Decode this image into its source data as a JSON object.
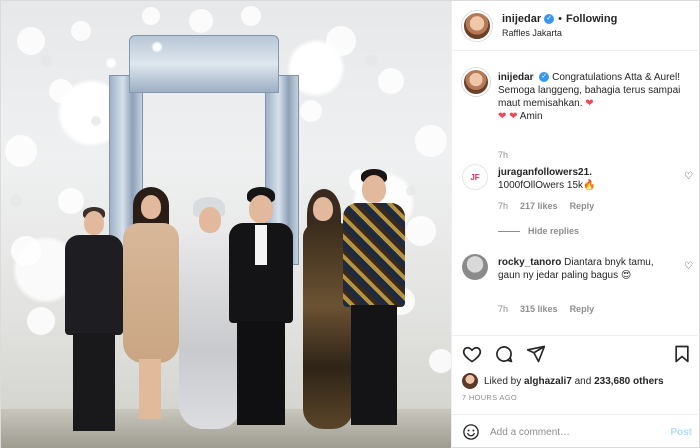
{
  "header": {
    "username": "inijedar",
    "separator": "•",
    "follow_state": "Following",
    "location": "Raffles Jakarta"
  },
  "caption": {
    "username": "inijedar",
    "text": "Congratulations Atta & Aurel! Semoga langgeng, bahagia terus sampai maut memisahkan.",
    "hearts_after": "❤",
    "hearts_line": "❤ ❤",
    "amin": "Amin",
    "time": "7h"
  },
  "comments": [
    {
      "username": "juraganfollowers21.",
      "text": "1000fOllOwers 15k",
      "emoji": "🔥",
      "time": "7h",
      "likes": "217 likes",
      "reply": "Reply",
      "avatar_text": "JF"
    },
    {
      "username": "rocky_tanoro",
      "text": "Diantara bnyk tamu, gaun ny jedar paling bagus",
      "emoji": "😍",
      "time": "7h",
      "likes": "315 likes",
      "reply": "Reply"
    }
  ],
  "hide_replies": "Hide replies",
  "icons": {
    "like": "heart-outline-icon",
    "comment": "comment-bubble-icon",
    "share": "paper-plane-icon",
    "save": "bookmark-icon",
    "emoji": "smiley-icon"
  },
  "likes": {
    "prefix": "Liked by",
    "user": "alghazali7",
    "middle": "and",
    "count": "233,680 others"
  },
  "timestamp": "7 HOURS AGO",
  "composer": {
    "placeholder": "Add a comment…",
    "post_label": "Post"
  },
  "colors": {
    "verified": "#3897f0",
    "heart_red": "#ed4956",
    "post_disabled": "#b3dbff"
  }
}
